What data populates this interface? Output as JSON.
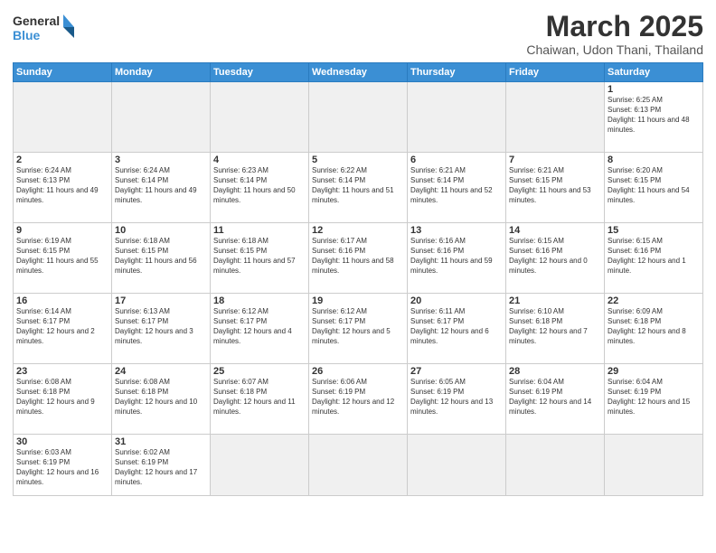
{
  "logo": {
    "text_general": "General",
    "text_blue": "Blue"
  },
  "header": {
    "month_year": "March 2025",
    "location": "Chaiwan, Udon Thani, Thailand"
  },
  "weekdays": [
    "Sunday",
    "Monday",
    "Tuesday",
    "Wednesday",
    "Thursday",
    "Friday",
    "Saturday"
  ],
  "days": [
    {
      "num": "",
      "empty": true
    },
    {
      "num": "",
      "empty": true
    },
    {
      "num": "",
      "empty": true
    },
    {
      "num": "",
      "empty": true
    },
    {
      "num": "",
      "empty": true
    },
    {
      "num": "",
      "empty": true
    },
    {
      "num": "1",
      "sunrise": "6:25 AM",
      "sunset": "6:13 PM",
      "daylight": "11 hours and 48 minutes."
    },
    {
      "num": "2",
      "sunrise": "6:24 AM",
      "sunset": "6:13 PM",
      "daylight": "11 hours and 49 minutes."
    },
    {
      "num": "3",
      "sunrise": "6:24 AM",
      "sunset": "6:14 PM",
      "daylight": "11 hours and 49 minutes."
    },
    {
      "num": "4",
      "sunrise": "6:23 AM",
      "sunset": "6:14 PM",
      "daylight": "11 hours and 50 minutes."
    },
    {
      "num": "5",
      "sunrise": "6:22 AM",
      "sunset": "6:14 PM",
      "daylight": "11 hours and 51 minutes."
    },
    {
      "num": "6",
      "sunrise": "6:21 AM",
      "sunset": "6:14 PM",
      "daylight": "11 hours and 52 minutes."
    },
    {
      "num": "7",
      "sunrise": "6:21 AM",
      "sunset": "6:15 PM",
      "daylight": "11 hours and 53 minutes."
    },
    {
      "num": "8",
      "sunrise": "6:20 AM",
      "sunset": "6:15 PM",
      "daylight": "11 hours and 54 minutes."
    },
    {
      "num": "9",
      "sunrise": "6:19 AM",
      "sunset": "6:15 PM",
      "daylight": "11 hours and 55 minutes."
    },
    {
      "num": "10",
      "sunrise": "6:18 AM",
      "sunset": "6:15 PM",
      "daylight": "11 hours and 56 minutes."
    },
    {
      "num": "11",
      "sunrise": "6:18 AM",
      "sunset": "6:15 PM",
      "daylight": "11 hours and 57 minutes."
    },
    {
      "num": "12",
      "sunrise": "6:17 AM",
      "sunset": "6:16 PM",
      "daylight": "11 hours and 58 minutes."
    },
    {
      "num": "13",
      "sunrise": "6:16 AM",
      "sunset": "6:16 PM",
      "daylight": "11 hours and 59 minutes."
    },
    {
      "num": "14",
      "sunrise": "6:15 AM",
      "sunset": "6:16 PM",
      "daylight": "12 hours and 0 minutes."
    },
    {
      "num": "15",
      "sunrise": "6:15 AM",
      "sunset": "6:16 PM",
      "daylight": "12 hours and 1 minute."
    },
    {
      "num": "16",
      "sunrise": "6:14 AM",
      "sunset": "6:17 PM",
      "daylight": "12 hours and 2 minutes."
    },
    {
      "num": "17",
      "sunrise": "6:13 AM",
      "sunset": "6:17 PM",
      "daylight": "12 hours and 3 minutes."
    },
    {
      "num": "18",
      "sunrise": "6:12 AM",
      "sunset": "6:17 PM",
      "daylight": "12 hours and 4 minutes."
    },
    {
      "num": "19",
      "sunrise": "6:12 AM",
      "sunset": "6:17 PM",
      "daylight": "12 hours and 5 minutes."
    },
    {
      "num": "20",
      "sunrise": "6:11 AM",
      "sunset": "6:17 PM",
      "daylight": "12 hours and 6 minutes."
    },
    {
      "num": "21",
      "sunrise": "6:10 AM",
      "sunset": "6:18 PM",
      "daylight": "12 hours and 7 minutes."
    },
    {
      "num": "22",
      "sunrise": "6:09 AM",
      "sunset": "6:18 PM",
      "daylight": "12 hours and 8 minutes."
    },
    {
      "num": "23",
      "sunrise": "6:08 AM",
      "sunset": "6:18 PM",
      "daylight": "12 hours and 9 minutes."
    },
    {
      "num": "24",
      "sunrise": "6:08 AM",
      "sunset": "6:18 PM",
      "daylight": "12 hours and 10 minutes."
    },
    {
      "num": "25",
      "sunrise": "6:07 AM",
      "sunset": "6:18 PM",
      "daylight": "12 hours and 11 minutes."
    },
    {
      "num": "26",
      "sunrise": "6:06 AM",
      "sunset": "6:19 PM",
      "daylight": "12 hours and 12 minutes."
    },
    {
      "num": "27",
      "sunrise": "6:05 AM",
      "sunset": "6:19 PM",
      "daylight": "12 hours and 13 minutes."
    },
    {
      "num": "28",
      "sunrise": "6:04 AM",
      "sunset": "6:19 PM",
      "daylight": "12 hours and 14 minutes."
    },
    {
      "num": "29",
      "sunrise": "6:04 AM",
      "sunset": "6:19 PM",
      "daylight": "12 hours and 15 minutes."
    },
    {
      "num": "30",
      "sunrise": "6:03 AM",
      "sunset": "6:19 PM",
      "daylight": "12 hours and 16 minutes."
    },
    {
      "num": "31",
      "sunrise": "6:02 AM",
      "sunset": "6:19 PM",
      "daylight": "12 hours and 17 minutes."
    },
    {
      "num": "",
      "empty": true
    },
    {
      "num": "",
      "empty": true
    },
    {
      "num": "",
      "empty": true
    },
    {
      "num": "",
      "empty": true
    },
    {
      "num": "",
      "empty": true
    }
  ]
}
